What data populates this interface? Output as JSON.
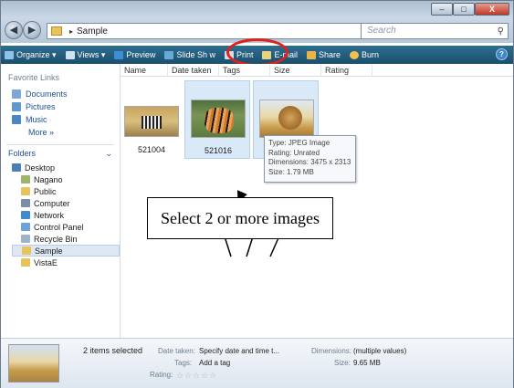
{
  "window": {
    "minimize": "–",
    "maximize": "□",
    "close": "X"
  },
  "address": {
    "path": "Sample",
    "search_placeholder": "Search"
  },
  "toolbar": {
    "organize": "Organize ▾",
    "views": "Views ▾",
    "preview": "Preview",
    "slideshow": "Slide Sh w",
    "print": "Print",
    "email": "E-mail",
    "share": "Share",
    "burn": "Burn",
    "help": "?"
  },
  "navpane": {
    "favorite_heading": "Favorite Links",
    "favorites": [
      "Documents",
      "Pictures",
      "Music"
    ],
    "more": "More »",
    "folders_label": "Folders",
    "folders_chevron": "⌄",
    "tree": [
      "Desktop",
      "Nagano",
      "Public",
      "Computer",
      "Network",
      "Control Panel",
      "Recycle Bin",
      "Sample",
      "VistaE"
    ]
  },
  "columns": [
    "Name",
    "Date taken",
    "Tags",
    "Size",
    "Rating"
  ],
  "files": [
    {
      "name": "521004"
    },
    {
      "name": "521016"
    },
    {
      "name": ""
    }
  ],
  "tooltip": {
    "type": "Type: JPEG Image",
    "rating": "Rating: Unrated",
    "dimensions": "Dimensions: 3475 x 2313",
    "size": "Size: 1.79 MB"
  },
  "callout": "Select 2 or more images",
  "details": {
    "count": "2 items selected",
    "date_label": "Date taken:",
    "date_value": "Specify date and time t...",
    "dims_label": "Dimensions:",
    "dims_value": "(multiple values)",
    "tags_label": "Tags:",
    "tags_value": "Add a tag",
    "size_label": "Size:",
    "size_value": "9.65 MB",
    "rating_label": "Rating:",
    "rating_stars": "☆☆☆☆☆"
  },
  "colors": {
    "toolbar_bg": "#1b4f6e",
    "highlight": "#d9e9f8",
    "annotation": "#e0221c",
    "link": "#1e4f9a"
  }
}
